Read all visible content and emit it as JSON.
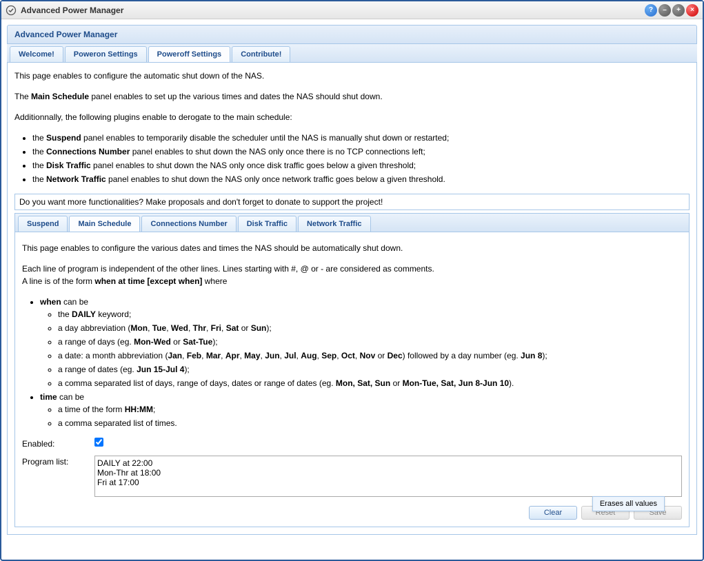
{
  "window": {
    "title": "Advanced Power Manager"
  },
  "panel": {
    "title": "Advanced Power Manager"
  },
  "mainTabs": {
    "welcome": "Welcome!",
    "poweron": "Poweron Settings",
    "poweroff": "Poweroff Settings",
    "contribute": "Contribute!"
  },
  "intro": {
    "line1": "This page enables to configure the automatic shut down of the NAS.",
    "line2_pre": "The ",
    "line2_b": "Main Schedule",
    "line2_post": " panel enables to set up the various times and dates the NAS should shut down.",
    "line3": "Additionnally, the following plugins enable to derogate to the main schedule:",
    "bullets": {
      "suspend_pre": "the ",
      "suspend_b": "Suspend",
      "suspend_post": " panel enables to temporarily disable the scheduler until the NAS is manually shut down or restarted;",
      "conn_pre": "the ",
      "conn_b": "Connections Number",
      "conn_post": " panel enables to shut down the NAS only once there is no TCP connections left;",
      "disk_pre": "the ",
      "disk_b": "Disk Traffic",
      "disk_post": " panel enables to shut down the NAS only once disk traffic goes below a given threshold;",
      "net_pre": "the ",
      "net_b": "Network Traffic",
      "net_post": " panel enables to shut down the NAS only once network traffic goes below a given threshold."
    }
  },
  "banner": "Do you want more functionalities? Make proposals and don't forget to donate to support the project!",
  "subTabs": {
    "suspend": "Suspend",
    "mainSchedule": "Main Schedule",
    "connections": "Connections Number",
    "diskTraffic": "Disk Traffic",
    "networkTraffic": "Network Traffic"
  },
  "schedule": {
    "intro": "This page enables to configure the various dates and times the NAS should be automatically shut down.",
    "help1_pre": "Each line of program is independent of the other lines. Lines starting with #, @ or - are considered as comments.",
    "help2_pre": "A line is of the form ",
    "help2_b": "when at time [except when]",
    "help2_post": " where",
    "when_label": "when",
    "when_can_be": " can be",
    "when_daily_pre": "the ",
    "when_daily_b": "DAILY",
    "when_daily_post": " keyword;",
    "when_abbr_text": "a day abbreviation (Mon, Tue, Wed, Thr, Fri, Sat or Sun);",
    "when_range_text": "a range of days (eg. Mon-Wed or Sat-Tue);",
    "when_date_text": "a date: a month abbreviation (Jan, Feb, Mar, Apr, May, Jun, Jul, Aug, Sep, Oct, Nov or Dec) followed by a day number (eg. Jun 8);",
    "when_daterange_text": "a range of dates (eg. Jun 15-Jul 4);",
    "when_comma_text": "a comma separated list of days, range of days, dates or range of dates (eg. Mon, Sat, Sun or Mon-Tue, Sat, Jun 8-Jun 10).",
    "time_label": "time",
    "time_can_be": " can be",
    "time_hhmm_pre": "a time of the form ",
    "time_hhmm_b": "HH:MM",
    "time_hhmm_post": ";",
    "time_comma": "a comma separated list of times."
  },
  "form": {
    "enabledLabel": "Enabled:",
    "enabledChecked": true,
    "programLabel": "Program list:",
    "programValue": "DAILY at 22:00\nMon-Thr at 18:00\nFri at 17:00"
  },
  "buttons": {
    "clear": "Clear",
    "reset": "Reset",
    "save": "Save"
  },
  "tooltip": "Erases all values"
}
